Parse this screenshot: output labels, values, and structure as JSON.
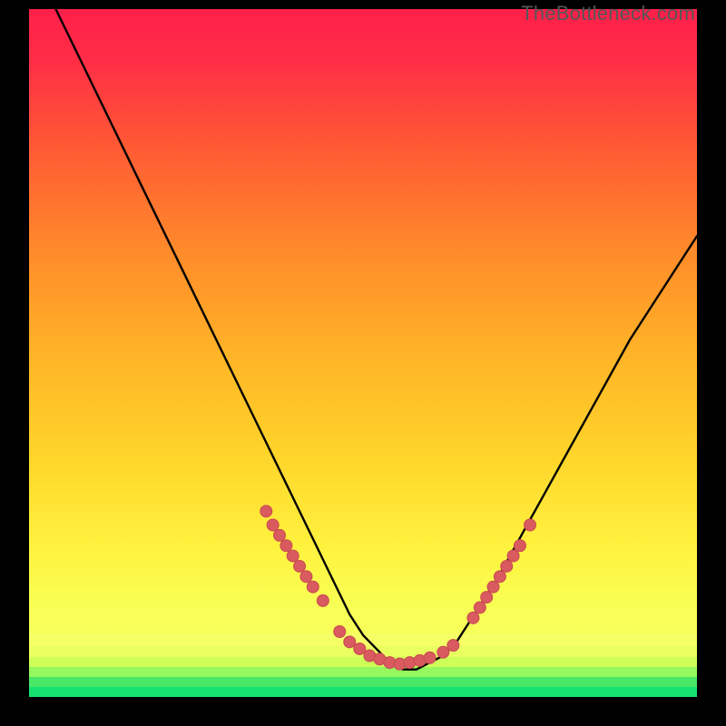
{
  "watermark": "TheBottleneck.com",
  "colors": {
    "frame_bg": "#000000",
    "gradient_top": "#ff1f4a",
    "gradient_mid1": "#ff6f2a",
    "gradient_mid2": "#ffca24",
    "gradient_mid3": "#fff84a",
    "gradient_bottom": "#16e36f",
    "curve": "#000000",
    "marker_fill": "#d95a5f",
    "marker_stroke": "#c94a50",
    "stripe1": "#f5ff66",
    "stripe2": "#eaff60",
    "stripe3": "#cdff58",
    "stripe4": "#95f85e",
    "stripe5": "#49e867",
    "stripe6": "#16e36f"
  },
  "chart_data": {
    "type": "line",
    "title": "",
    "xlabel": "",
    "ylabel": "",
    "xlim": [
      0,
      100
    ],
    "ylim": [
      0,
      100
    ],
    "grid": false,
    "legend": false,
    "series": [
      {
        "name": "bottleneck-curve",
        "x": [
          4,
          8,
          12,
          16,
          20,
          24,
          28,
          32,
          36,
          38,
          40,
          42,
          44,
          46,
          48,
          50,
          52,
          54,
          56,
          58,
          60,
          62,
          64,
          66,
          70,
          74,
          78,
          82,
          86,
          90,
          94,
          98,
          100
        ],
        "y": [
          100,
          92,
          84,
          76,
          68,
          60,
          52,
          44,
          36,
          32,
          28,
          24,
          20,
          16,
          12,
          9,
          7,
          5,
          4,
          4,
          5,
          6,
          8,
          11,
          17,
          24,
          31,
          38,
          45,
          52,
          58,
          64,
          67
        ]
      }
    ],
    "markers": [
      {
        "x": 35.5,
        "y": 27.0
      },
      {
        "x": 36.5,
        "y": 25.0
      },
      {
        "x": 37.5,
        "y": 23.5
      },
      {
        "x": 38.5,
        "y": 22.0
      },
      {
        "x": 39.5,
        "y": 20.5
      },
      {
        "x": 40.5,
        "y": 19.0
      },
      {
        "x": 41.5,
        "y": 17.5
      },
      {
        "x": 42.5,
        "y": 16.0
      },
      {
        "x": 44.0,
        "y": 14.0
      },
      {
        "x": 46.5,
        "y": 9.5
      },
      {
        "x": 48.0,
        "y": 8.0
      },
      {
        "x": 49.5,
        "y": 7.0
      },
      {
        "x": 51.0,
        "y": 6.0
      },
      {
        "x": 52.5,
        "y": 5.5
      },
      {
        "x": 54.0,
        "y": 5.0
      },
      {
        "x": 55.5,
        "y": 4.8
      },
      {
        "x": 57.0,
        "y": 5.0
      },
      {
        "x": 58.5,
        "y": 5.3
      },
      {
        "x": 60.0,
        "y": 5.7
      },
      {
        "x": 62.0,
        "y": 6.5
      },
      {
        "x": 63.5,
        "y": 7.5
      },
      {
        "x": 66.5,
        "y": 11.5
      },
      {
        "x": 67.5,
        "y": 13.0
      },
      {
        "x": 68.5,
        "y": 14.5
      },
      {
        "x": 69.5,
        "y": 16.0
      },
      {
        "x": 70.5,
        "y": 17.5
      },
      {
        "x": 71.5,
        "y": 19.0
      },
      {
        "x": 72.5,
        "y": 20.5
      },
      {
        "x": 73.5,
        "y": 22.0
      },
      {
        "x": 75.0,
        "y": 25.0
      }
    ]
  }
}
